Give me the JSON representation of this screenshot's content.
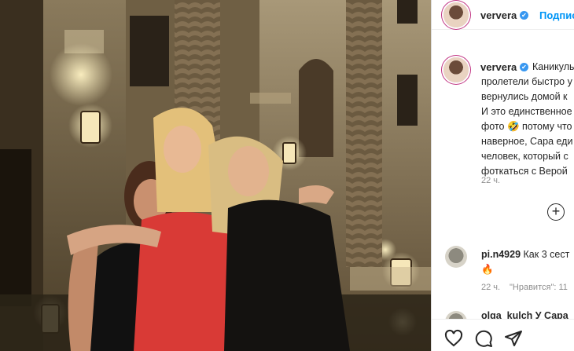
{
  "post": {
    "username": "ververa",
    "follow_label": "Подписаться",
    "caption_lines": [
      "Каникулы",
      "пролетели быстро у",
      "вернулись домой к",
      "И это единственное",
      "фото 🤣 потому что",
      "наверное, Сара еди",
      "человек, который с",
      "фоткаться с Верой"
    ],
    "caption_time": "22 ч.",
    "load_more_icon": "plus-circle-icon"
  },
  "comments": [
    {
      "username": "pi.n4929",
      "text": "Как 3 сест",
      "emoji": "🔥",
      "time": "22 ч.",
      "likes_label": "\"Нравится\": 11"
    },
    {
      "username": "olga_kulch У Сара"
    }
  ],
  "action_bar": {
    "like_icon": "heart-icon",
    "comment_icon": "comment-icon",
    "share_icon": "paper-plane-icon"
  },
  "colors": {
    "link": "#0095f6",
    "verified": "#3897f0",
    "muted": "#8e8e8e",
    "dress_red": "#d93a36"
  }
}
